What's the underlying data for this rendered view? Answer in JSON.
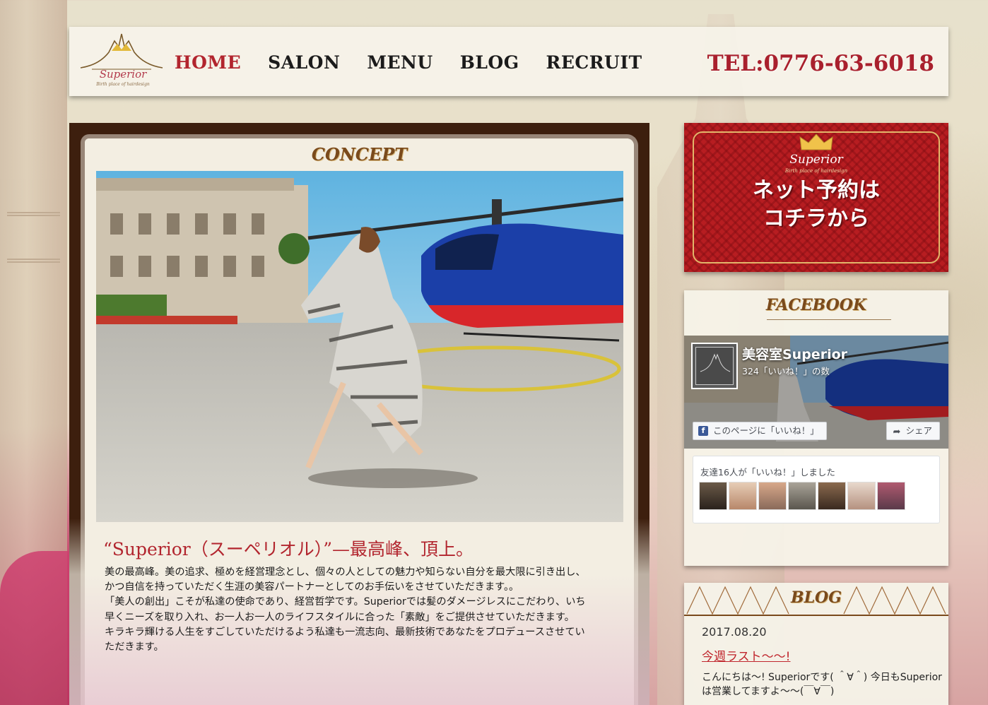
{
  "site": {
    "logo_text": "Superior",
    "logo_tagline": "Birth place of hairdesign",
    "phone": "TEL:0776-63-6018"
  },
  "nav": {
    "items": [
      {
        "label": "HOME",
        "active": true
      },
      {
        "label": "SALON",
        "active": false
      },
      {
        "label": "MENU",
        "active": false
      },
      {
        "label": "BLOG",
        "active": false
      },
      {
        "label": "RECRUIT",
        "active": false
      }
    ]
  },
  "concept": {
    "title": "CONCEPT",
    "headline": "“Superior（スーペリオル）”—最高峰、頂上。",
    "paragraphs": [
      "美の最高峰。美の追求、極めを経営理念とし、個々の人としての魅力や知らない自分を最大限に引き出し、かつ自信を持っていただく生涯の美容パートナーとしてのお手伝いをさせていただきます。。",
      "「美人の創出」こそが私達の使命であり、経営哲学です。Superiorでは髪のダメージレスにこだわり、いち早くニーズを取り入れ、お一人お一人のライフスタイルに合った「素敵」をご提供させていただきます。",
      "キラキラ輝ける人生をすごしていただけるよう私達も一流志向、最新技術であなたをプロデュースさせていただきます。"
    ]
  },
  "reserve": {
    "logo_text": "Superior",
    "logo_tagline": "Birth place of hairdesign",
    "line1": "ネット予約は",
    "line2": "コチラから"
  },
  "facebook": {
    "title": "FACEBOOK",
    "page_name": "美容室Superior",
    "likes": "324「いいね！」の数",
    "like_button": "このページに「いいね！」",
    "share_button": "シェア",
    "friends_text": "友達16人が「いいね！」しました"
  },
  "blog": {
    "title": "BLOG",
    "date": "2017.08.20",
    "post_title": "今週ラスト〜〜!",
    "excerpt": "こんにちは〜! Superiorです( ＾∀＾) 今日もSuperiorは営業してますよ〜〜(￣∀￣)"
  },
  "colors": {
    "accent_red": "#b2252e",
    "brown": "#7a4a1c",
    "facebook_blue": "#3b5998"
  }
}
